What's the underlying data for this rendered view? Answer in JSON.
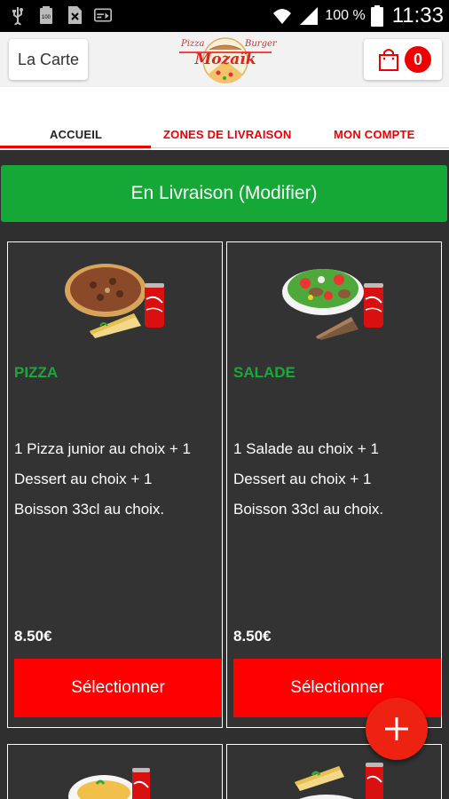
{
  "status_bar": {
    "left_icons": [
      "usb-icon",
      "battery-100-icon",
      "sim-blocked-icon",
      "cast-icon"
    ],
    "battery_percent": "100 %",
    "time": "11:33"
  },
  "app_bar": {
    "menu_button": "La Carte",
    "logo_words": {
      "left": "Pizza",
      "right": "Burger",
      "brand": "Mozaïk"
    },
    "cart_count": "0"
  },
  "tabs": [
    {
      "label": "ACCUEIL",
      "active": true
    },
    {
      "label": "ZONES DE LIVRAISON",
      "active": false
    },
    {
      "label": "MON COMPTE",
      "active": false
    }
  ],
  "delivery_button": "En Livraison (Modifier)",
  "menus": [
    {
      "name": "PIZZA",
      "desc_lines": [
        "1 Pizza junior au choix  + 1",
        "Dessert au choix  + 1",
        "Boisson 33cl au choix."
      ],
      "price": "8.50€",
      "button": "Sélectionner"
    },
    {
      "name": "SALADE",
      "desc_lines": [
        "1 Salade au choix  + 1",
        "Dessert au choix  + 1",
        "Boisson 33cl au choix."
      ],
      "price": "8.50€",
      "button": "Sélectionner"
    }
  ],
  "colors": {
    "accent_red": "#ee0000",
    "brand_green": "#16a837",
    "card_bg": "#333333"
  },
  "fab_icon": "plus-icon"
}
